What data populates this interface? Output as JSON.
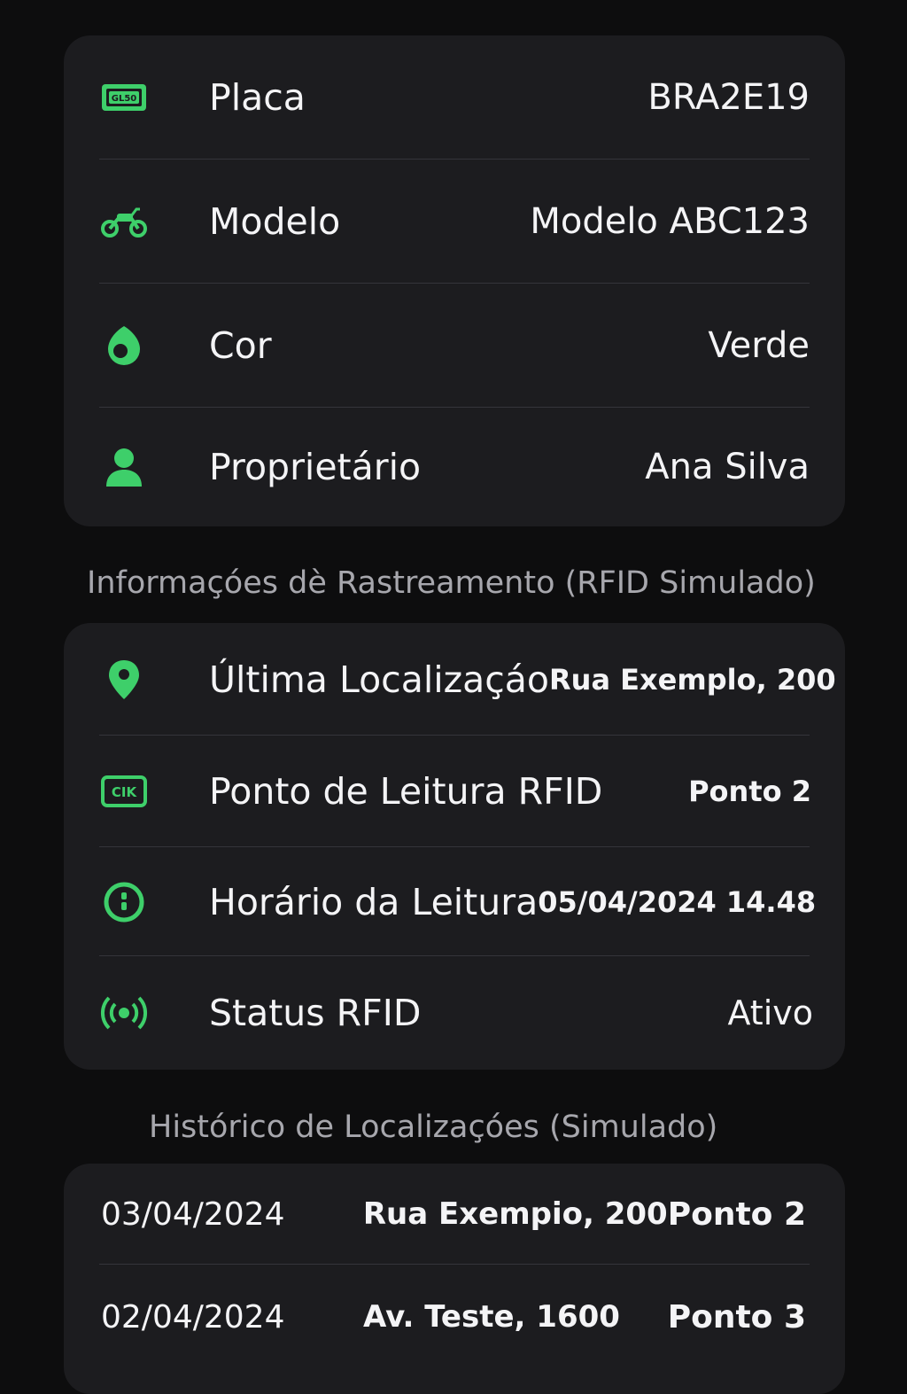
{
  "vehicle": {
    "rows": [
      {
        "icon": "license-plate-icon",
        "label": "Placa",
        "value": "BRA2E19"
      },
      {
        "icon": "motorcycle-icon",
        "label": "Modelo",
        "value": "Modelo ABC123"
      },
      {
        "icon": "paint-drop-icon",
        "label": "Cor",
        "value": "Verde"
      },
      {
        "icon": "person-icon",
        "label": "Proprietário",
        "value": "Ana Silva"
      }
    ]
  },
  "tracking": {
    "title": "Informaçóes dè Rastreamento (RFID Simulado)",
    "rows": [
      {
        "icon": "location-pin-icon",
        "label": "Última Localizaçáo",
        "value": "Rua Exemplo, 200"
      },
      {
        "icon": "rfid-reader-icon",
        "label": "Ponto de Leitura RFID",
        "value": "Ponto 2"
      },
      {
        "icon": "clock-icon",
        "label": "Horário da Leitura",
        "value": "05/04/2024 14.48"
      },
      {
        "icon": "signal-broadcast-icon",
        "label": "Status RFID",
        "value": "Ativo"
      }
    ]
  },
  "history": {
    "title": "Histórico de Localizaçóes (Simulado)",
    "rows": [
      {
        "date": "03/04/2024",
        "address": "Rua Exempio, 200",
        "point": "Ponto 2"
      },
      {
        "date": "02/04/2024",
        "address": "Av. Teste, 1600",
        "point": "Ponto 3"
      }
    ]
  },
  "colors": {
    "accent": "#3ecf6a",
    "background": "#0d0d0e",
    "card": "#1c1c1f",
    "section_title": "#a7a7ad"
  }
}
